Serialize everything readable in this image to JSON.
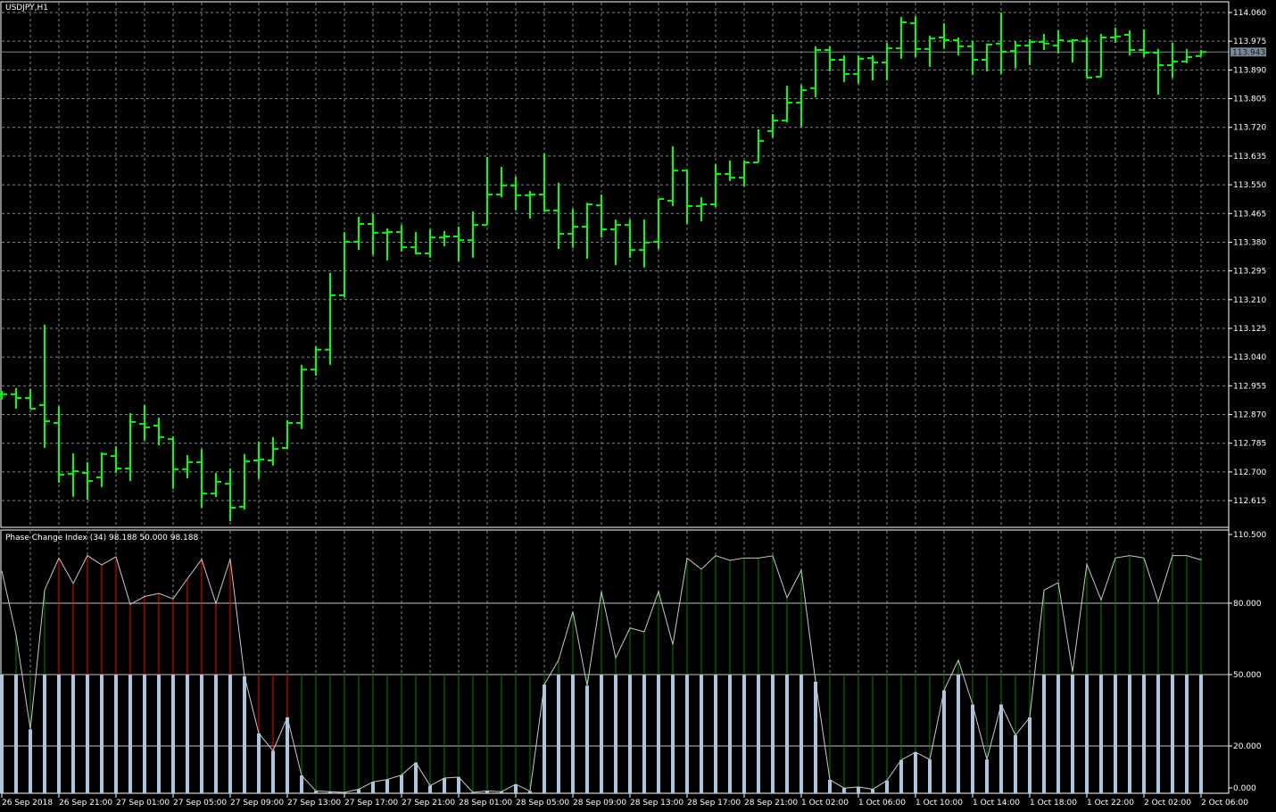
{
  "window": {
    "symbol_title": "USDJPY,H1"
  },
  "colors": {
    "background": "#000000",
    "bar": "#00ff00",
    "grid": "#778899",
    "axis": "#ffffff",
    "pci_line": "#c8c8c8",
    "hist_base": "#b0c4de",
    "up": "#008000",
    "down": "#ff0000",
    "price_tag": "#778899"
  },
  "price_axis": {
    "labels": [
      "114.060",
      "113.975",
      "113.890",
      "113.805",
      "113.720",
      "113.635",
      "113.550",
      "113.465",
      "113.380",
      "113.295",
      "113.210",
      "113.125",
      "113.040",
      "112.955",
      "112.870",
      "112.785",
      "112.700",
      "112.615"
    ],
    "current_price": "113.943"
  },
  "indicator": {
    "title": "Phase Change Index (34) 98.188 50.000 98.188",
    "axis_labels": [
      "110.500",
      "80.000",
      "50.000",
      "20.000",
      "0.000"
    ],
    "levels": [
      80,
      50,
      20
    ],
    "range": [
      0,
      110.5
    ]
  },
  "time_axis": {
    "labels": [
      "26 Sep 2018",
      "26 Sep 21:00",
      "27 Sep 01:00",
      "27 Sep 05:00",
      "27 Sep 09:00",
      "27 Sep 13:00",
      "27 Sep 17:00",
      "27 Sep 21:00",
      "28 Sep 01:00",
      "28 Sep 05:00",
      "28 Sep 09:00",
      "28 Sep 13:00",
      "28 Sep 17:00",
      "28 Sep 21:00",
      "1 Oct 02:00",
      "1 Oct 06:00",
      "1 Oct 10:00",
      "1 Oct 14:00",
      "1 Oct 18:00",
      "1 Oct 22:00",
      "2 Oct 02:00",
      "2 Oct 06:00"
    ]
  },
  "chart_data": [
    {
      "type": "ohlc",
      "title": "USDJPY,H1",
      "ylim": [
        112.57,
        114.09
      ],
      "ohlc": [
        [
          112.93,
          112.94,
          112.914,
          112.93
        ],
        [
          112.93,
          112.948,
          112.887,
          112.919
        ],
        [
          112.919,
          112.945,
          112.887,
          112.887
        ],
        [
          112.898,
          113.136,
          112.771,
          112.85
        ],
        [
          112.845,
          112.895,
          112.668,
          112.692
        ],
        [
          112.694,
          112.755,
          112.626,
          112.702
        ],
        [
          112.697,
          112.729,
          112.618,
          112.673
        ],
        [
          112.684,
          112.758,
          112.655,
          112.753
        ],
        [
          112.747,
          112.776,
          112.697,
          112.71
        ],
        [
          112.71,
          112.874,
          112.673,
          112.848
        ],
        [
          112.842,
          112.898,
          112.792,
          112.832
        ],
        [
          112.837,
          112.861,
          112.779,
          112.803
        ],
        [
          112.797,
          112.805,
          112.65,
          112.708
        ],
        [
          112.708,
          112.75,
          112.681,
          112.729
        ],
        [
          112.729,
          112.768,
          112.594,
          112.636
        ],
        [
          112.636,
          112.697,
          112.626,
          112.671
        ],
        [
          112.665,
          112.71,
          112.554,
          112.594
        ],
        [
          112.597,
          112.753,
          112.589,
          112.731
        ],
        [
          112.734,
          112.79,
          112.679,
          112.737
        ],
        [
          112.734,
          112.803,
          112.719,
          112.768
        ],
        [
          112.771,
          112.853,
          112.768,
          112.845
        ],
        [
          112.845,
          113.017,
          112.827,
          113.003
        ],
        [
          113.003,
          113.072,
          112.985,
          113.062
        ],
        [
          113.062,
          113.289,
          113.017,
          113.223
        ],
        [
          113.223,
          113.41,
          113.217,
          113.381
        ],
        [
          113.381,
          113.455,
          113.357,
          113.434
        ],
        [
          113.434,
          113.463,
          113.342,
          113.408
        ],
        [
          113.408,
          113.421,
          113.326,
          113.41
        ],
        [
          113.41,
          113.431,
          113.352,
          113.365
        ],
        [
          113.365,
          113.41,
          113.344,
          113.347
        ],
        [
          113.347,
          113.418,
          113.334,
          113.394
        ],
        [
          113.394,
          113.413,
          113.368,
          113.397
        ],
        [
          113.397,
          113.426,
          113.323,
          113.386
        ],
        [
          113.386,
          113.471,
          113.334,
          113.431
        ],
        [
          113.431,
          113.632,
          113.431,
          113.521
        ],
        [
          113.521,
          113.603,
          113.513,
          113.548
        ],
        [
          113.548,
          113.574,
          113.474,
          113.519
        ],
        [
          113.519,
          113.532,
          113.45,
          113.521
        ],
        [
          113.521,
          113.643,
          113.471,
          113.474
        ],
        [
          113.474,
          113.556,
          113.36,
          113.405
        ],
        [
          113.405,
          113.479,
          113.363,
          113.426
        ],
        [
          113.426,
          113.497,
          113.331,
          113.492
        ],
        [
          113.489,
          113.521,
          113.394,
          113.418
        ],
        [
          113.418,
          113.447,
          113.312,
          113.431
        ],
        [
          113.431,
          113.447,
          113.334,
          113.357
        ],
        [
          113.357,
          113.447,
          113.305,
          113.379
        ],
        [
          113.381,
          113.508,
          113.36,
          113.508
        ],
        [
          113.503,
          113.664,
          113.487,
          113.592
        ],
        [
          113.592,
          113.595,
          113.434,
          113.487
        ],
        [
          113.487,
          113.513,
          113.442,
          113.492
        ],
        [
          113.492,
          113.611,
          113.484,
          113.582
        ],
        [
          113.582,
          113.622,
          113.561,
          113.571
        ],
        [
          113.571,
          113.622,
          113.545,
          113.616
        ],
        [
          113.616,
          113.714,
          113.616,
          113.68
        ],
        [
          113.709,
          113.759,
          113.69,
          113.74
        ],
        [
          113.74,
          113.843,
          113.735,
          113.793
        ],
        [
          113.793,
          113.846,
          113.722,
          113.83
        ],
        [
          113.836,
          113.96,
          113.809,
          113.949
        ],
        [
          113.949,
          113.96,
          113.886,
          113.92
        ],
        [
          113.92,
          113.933,
          113.854,
          113.878
        ],
        [
          113.878,
          113.933,
          113.849,
          113.923
        ],
        [
          113.925,
          113.933,
          113.859,
          113.912
        ],
        [
          113.912,
          113.97,
          113.859,
          113.954
        ],
        [
          113.954,
          114.047,
          113.923,
          114.031
        ],
        [
          114.028,
          114.049,
          113.928,
          113.952
        ],
        [
          113.952,
          113.991,
          113.899,
          113.983
        ],
        [
          113.986,
          114.028,
          113.952,
          113.978
        ],
        [
          113.978,
          113.986,
          113.933,
          113.96
        ],
        [
          113.96,
          113.975,
          113.875,
          113.92
        ],
        [
          113.92,
          113.968,
          113.886,
          113.965
        ],
        [
          113.968,
          114.06,
          113.878,
          113.944
        ],
        [
          113.946,
          113.975,
          113.894,
          113.962
        ],
        [
          113.962,
          113.981,
          113.904,
          113.973
        ],
        [
          113.973,
          113.997,
          113.949,
          113.968
        ],
        [
          113.962,
          114.007,
          113.939,
          113.978
        ],
        [
          113.975,
          113.981,
          113.912,
          113.978
        ],
        [
          113.975,
          113.986,
          113.867,
          113.867
        ],
        [
          113.87,
          113.997,
          113.87,
          113.986
        ],
        [
          113.986,
          114.015,
          113.97,
          113.989
        ],
        [
          113.994,
          114.007,
          113.933,
          113.949
        ],
        [
          113.949,
          114.01,
          113.928,
          113.941
        ],
        [
          113.941,
          113.952,
          113.817,
          113.904
        ],
        [
          113.904,
          113.97,
          113.867,
          113.915
        ],
        [
          113.915,
          113.952,
          113.91,
          113.928
        ],
        [
          113.931,
          113.949,
          113.931,
          113.943
        ]
      ]
    },
    {
      "type": "line+histogram",
      "title": "Phase Change Index (34)",
      "ylim": [
        0,
        110.5
      ],
      "pci": [
        93.6,
        66.8,
        27.0,
        85.5,
        99.0,
        88.3,
        100.0,
        96.1,
        99.5,
        79.5,
        82.8,
        84.1,
        81.8,
        90.3,
        98.4,
        79.9,
        98.6,
        49.3,
        25.3,
        18.0,
        32.0,
        7.6,
        1.1,
        0.8,
        0.5,
        1.8,
        4.9,
        5.9,
        7.8,
        13.0,
        3.3,
        6.5,
        6.9,
        0.5,
        1.1,
        0.8,
        3.9,
        1.0,
        45.8,
        56.1,
        76.5,
        45.3,
        84.9,
        57.0,
        69.6,
        68.0,
        84.9,
        62.6,
        98.9,
        94.3,
        100.0,
        98.0,
        99.0,
        99.0,
        99.9,
        82.3,
        93.9,
        47.0,
        5.8,
        2.3,
        2.8,
        1.8,
        5.5,
        14.1,
        17.4,
        14.3,
        43.4,
        56.1,
        37.4,
        14.3,
        37.4,
        24.5,
        32.0,
        85.5,
        88.6,
        51.1,
        96.4,
        81.4,
        99.0,
        100.0,
        99.0,
        80.5,
        100.0,
        100.0,
        98.188
      ],
      "state": "nggg rrrrrrrrrrrrrrrrrggggggggggggggggggggggggggggggggggggggggggggggggggggggggggggggggg"
    }
  ]
}
